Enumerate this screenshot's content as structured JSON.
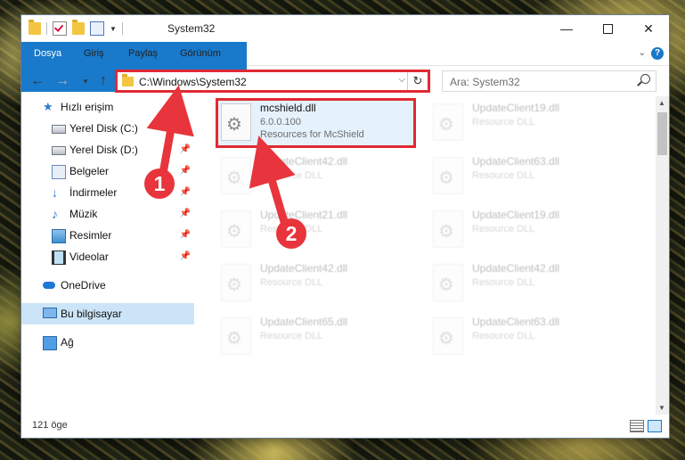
{
  "window": {
    "title": "System32"
  },
  "ribbon": {
    "tabs": [
      {
        "label": "Dosya"
      },
      {
        "label": "Giriş"
      },
      {
        "label": "Paylaş"
      },
      {
        "label": "Görünüm"
      }
    ],
    "help": "?"
  },
  "address": {
    "path": "C:\\Windows\\System32",
    "search_placeholder": "Ara: System32"
  },
  "nav": {
    "items": [
      {
        "label": "Hızlı erişim",
        "icon": "star-icon",
        "pinned": false
      },
      {
        "label": "Yerel Disk (C:)",
        "icon": "drive-icon",
        "pinned": true
      },
      {
        "label": "Yerel Disk (D:)",
        "icon": "drive-icon",
        "pinned": true
      },
      {
        "label": "Belgeler",
        "icon": "documents-icon",
        "pinned": true
      },
      {
        "label": "İndirmeler",
        "icon": "downloads-icon",
        "pinned": true
      },
      {
        "label": "Müzik",
        "icon": "music-icon",
        "pinned": true
      },
      {
        "label": "Resimler",
        "icon": "pictures-icon",
        "pinned": true
      },
      {
        "label": "Videolar",
        "icon": "videos-icon",
        "pinned": true
      },
      {
        "label": "OneDrive",
        "icon": "cloud-icon",
        "pinned": false
      },
      {
        "label": "Bu bilgisayar",
        "icon": "computer-icon",
        "pinned": false,
        "selected": true
      },
      {
        "label": "Ağ",
        "icon": "network-icon",
        "pinned": false
      }
    ]
  },
  "files": [
    {
      "name": "mcshield.dll",
      "version": "6.0.0.100",
      "desc": "Resources for McShield",
      "highlighted": true
    },
    {
      "name": "UpdateClient19.dll",
      "desc": "Resource DLL"
    },
    {
      "name": "UpdateClient42.dll",
      "desc": "Resource DLL"
    },
    {
      "name": "UpdateClient63.dll",
      "desc": "Resource DLL"
    },
    {
      "name": "UpdateClient21.dll",
      "desc": "Resource DLL"
    },
    {
      "name": "UpdateClient19.dll",
      "desc": "Resource DLL"
    },
    {
      "name": "UpdateClient42.dll",
      "desc": "Resource DLL"
    },
    {
      "name": "UpdateClient42.dll",
      "desc": "Resource DLL"
    },
    {
      "name": "UpdateClient65.dll",
      "desc": "Resource DLL"
    },
    {
      "name": "UpdateClient63.dll",
      "desc": "Resource DLL"
    }
  ],
  "status": {
    "count": "121 öge"
  },
  "annotations": [
    {
      "number": "1"
    },
    {
      "number": "2"
    }
  ],
  "colors": {
    "accent": "#1979ca",
    "highlight": "#e02a33",
    "selection": "#cce4f7"
  }
}
